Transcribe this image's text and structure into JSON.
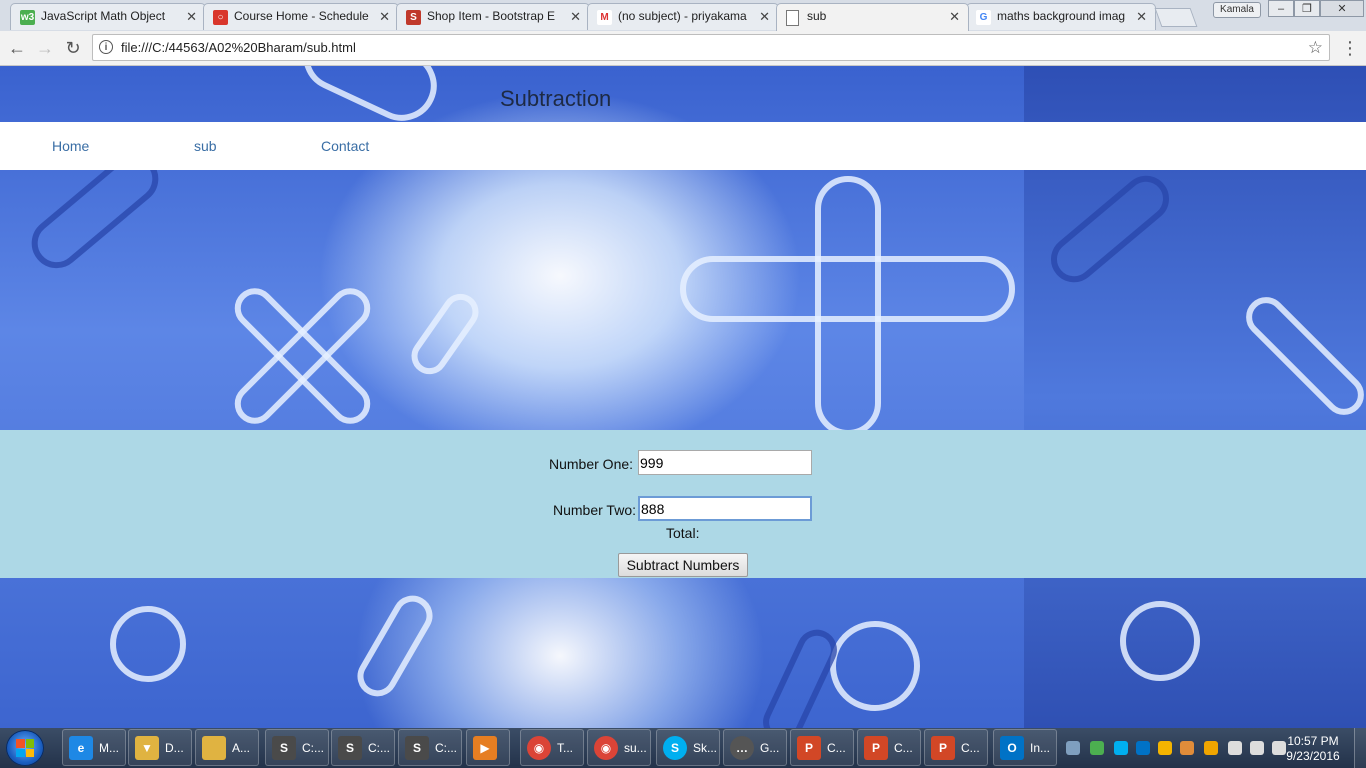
{
  "browser": {
    "tabs": [
      {
        "title": "JavaScript Math Object",
        "icon": "w3schools-icon",
        "color": "#4caf50",
        "glyph": "w3"
      },
      {
        "title": "Course Home - Schedule",
        "icon": "course-icon",
        "color": "#d9362b",
        "glyph": "○"
      },
      {
        "title": "Shop Item - Bootstrap E",
        "icon": "bootstrap-s-icon",
        "color": "#c0392b",
        "glyph": "S"
      },
      {
        "title": "(no subject) - priyakama",
        "icon": "gmail-icon",
        "color": "#ffffff",
        "glyph": "M"
      },
      {
        "title": "sub",
        "icon": "page-icon",
        "color": "#ffffff",
        "glyph": ""
      },
      {
        "title": "maths background imag",
        "icon": "google-icon",
        "color": "#ffffff",
        "glyph": "G"
      }
    ],
    "user_badge": "Kamala",
    "url": "file:///C:/44563/A02%20Bharam/sub.html"
  },
  "page": {
    "title": "Subtraction",
    "nav": [
      "Home",
      "sub",
      "Contact"
    ],
    "form": {
      "label_one": "Number One:",
      "value_one": "999",
      "label_two": "Number Two:",
      "value_two": "888",
      "total_label": "Total:",
      "button": "Subtract Numbers"
    }
  },
  "taskbar": {
    "items": [
      {
        "label": "M...",
        "icon": "ie-icon",
        "color": "#1e88e5",
        "glyph": "e"
      },
      {
        "label": "D...",
        "icon": "folder-download-icon",
        "color": "#e0b341",
        "glyph": "▼"
      },
      {
        "label": "A...",
        "icon": "folder-icon",
        "color": "#e0b341",
        "glyph": ""
      },
      {
        "label": "C:...",
        "icon": "sublime-icon",
        "color": "#4a4a4a",
        "glyph": "S"
      },
      {
        "label": "C:...",
        "icon": "sublime-icon",
        "color": "#4a4a4a",
        "glyph": "S"
      },
      {
        "label": "C:...",
        "icon": "sublime-icon",
        "color": "#4a4a4a",
        "glyph": "S"
      },
      {
        "label": "",
        "icon": "media-player-icon",
        "color": "#e67e22",
        "glyph": "▶"
      },
      {
        "label": "T...",
        "icon": "chrome-icon",
        "color": "#db4437",
        "glyph": "◉"
      },
      {
        "label": "su...",
        "icon": "chrome-icon",
        "color": "#db4437",
        "glyph": "◉"
      },
      {
        "label": "Sk...",
        "icon": "skype-icon",
        "color": "#00aff0",
        "glyph": "S"
      },
      {
        "label": "G...",
        "icon": "chat-icon",
        "color": "#555555",
        "glyph": "…"
      },
      {
        "label": "C...",
        "icon": "powerpoint-icon",
        "color": "#d24726",
        "glyph": "P"
      },
      {
        "label": "C...",
        "icon": "powerpoint-icon",
        "color": "#d24726",
        "glyph": "P"
      },
      {
        "label": "C...",
        "icon": "powerpoint-icon",
        "color": "#d24726",
        "glyph": "P"
      },
      {
        "label": "In...",
        "icon": "outlook-icon",
        "color": "#0072c6",
        "glyph": "O"
      }
    ],
    "tray_icons": [
      {
        "icon": "network-tray-icon",
        "color": "#7f9fbf"
      },
      {
        "icon": "sync-tray-icon",
        "color": "#4caf50"
      },
      {
        "icon": "skype-tray-icon",
        "color": "#00aff0"
      },
      {
        "icon": "outlook-tray-icon",
        "color": "#0072c6"
      },
      {
        "icon": "drive-tray-icon",
        "color": "#f4b400"
      },
      {
        "icon": "cloud-tray-icon",
        "color": "#e08c3a"
      },
      {
        "icon": "shield-tray-icon",
        "color": "#f0a500"
      },
      {
        "icon": "battery-tray-icon",
        "color": "#dddddd"
      },
      {
        "icon": "signal-tray-icon",
        "color": "#dddddd"
      },
      {
        "icon": "volume-muted-tray-icon",
        "color": "#dddddd"
      }
    ],
    "clock_time": "10:57 PM",
    "clock_date": "9/23/2016"
  }
}
